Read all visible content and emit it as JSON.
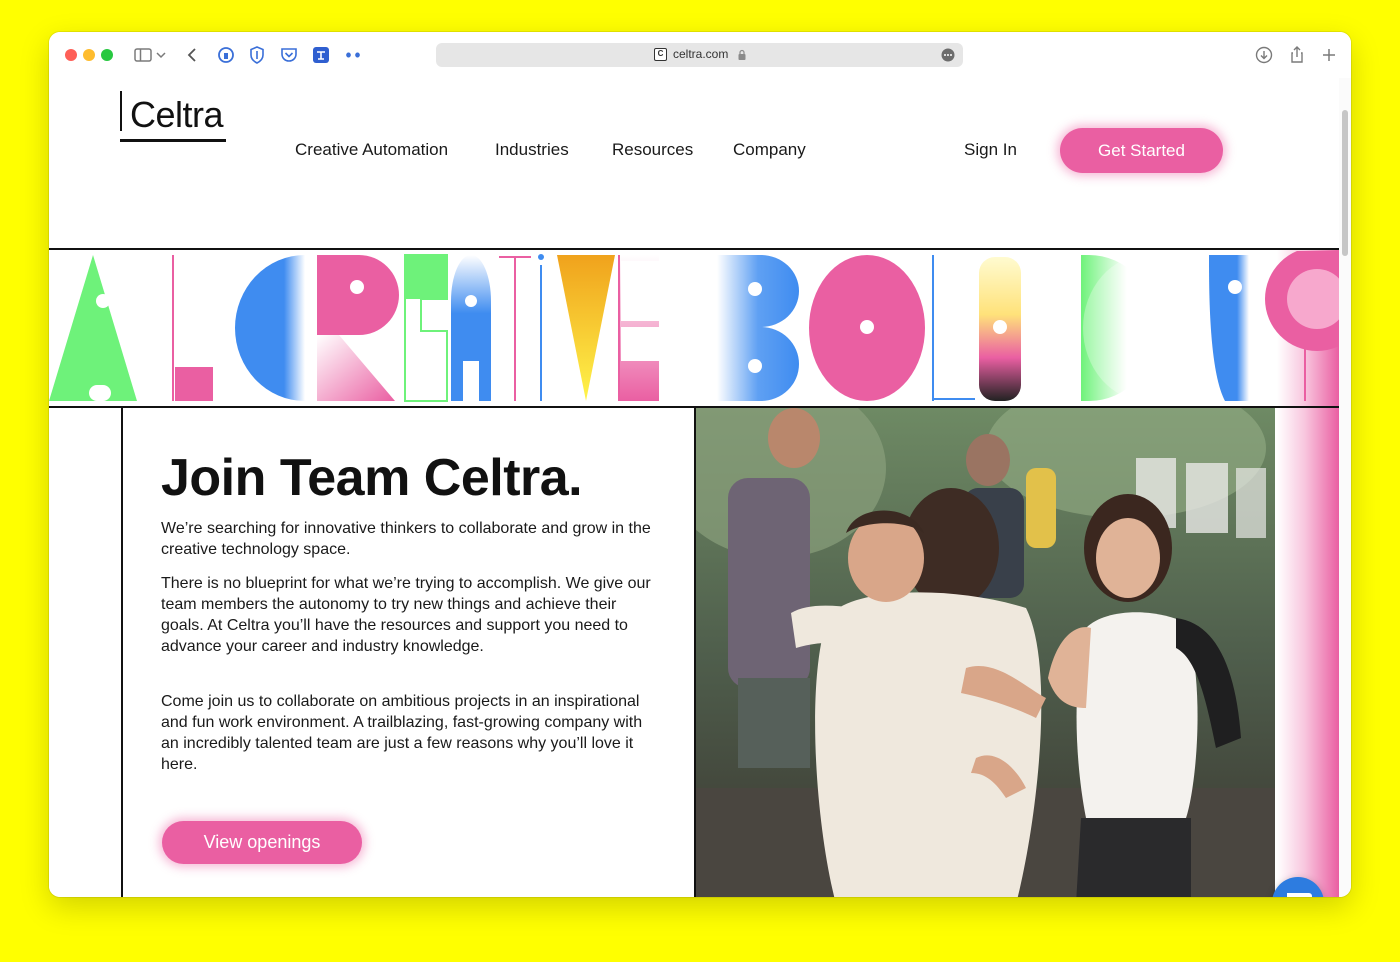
{
  "browser": {
    "url": "celtra.com",
    "site_icon_letter": "C"
  },
  "header": {
    "logo_text": "Celtra",
    "nav": [
      {
        "label": "Creative Automation"
      },
      {
        "label": "Industries"
      },
      {
        "label": "Resources"
      },
      {
        "label": "Company"
      }
    ],
    "sign_in": "Sign In",
    "cta": "Get Started"
  },
  "main": {
    "title": "Join Team Celtra.",
    "paragraphs": [
      "We’re searching for innovative thinkers to collaborate and grow in the creative technology space.",
      "There is no blueprint for what we’re trying to accomplish. We give our team members the autonomy to try new things and achieve their goals. At Celtra you’ll have the resources and support you need to advance your career and industry knowledge.",
      "Come join us to collaborate on ambitious projects in an inspirational and fun work environment. A trailblazing, fast-growing company with an incredibly talented team are just a few reasons why you’ll love it here."
    ],
    "cta": "View openings"
  },
  "colors": {
    "accent_pink": "#ea5fa2",
    "brand_blue": "#3f8cf0",
    "brand_green": "#6ef27a",
    "page_background": "#FFFF00",
    "chat_blue": "#2d7ce0"
  },
  "icons": [
    "sidebar-icon",
    "chevron-down-icon",
    "back-icon",
    "privacy-icon",
    "shield-icon",
    "pocket-icon",
    "translate-icon",
    "extension-icon",
    "lock-icon",
    "more-icon",
    "download-icon",
    "share-icon",
    "new-tab-icon",
    "chat-icon"
  ]
}
